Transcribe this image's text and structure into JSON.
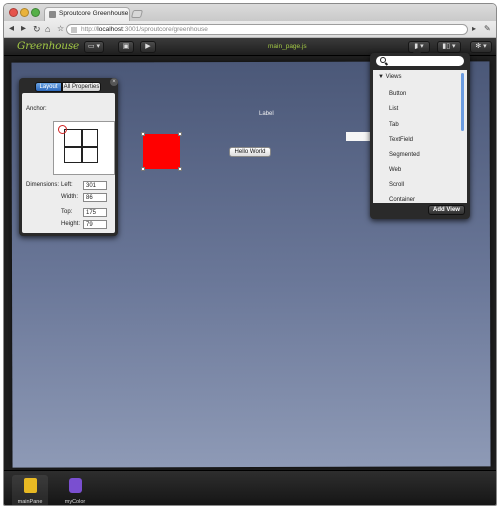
{
  "browser": {
    "tab_title": "Sproutcore Greenhouse",
    "tab_close": "×",
    "url_prefix": "http://",
    "url_host": "localhost",
    "url_path": ":3001/sproutcore/greenhouse",
    "nav_back": "◂",
    "nav_forward": "▸",
    "nav_reload": "↻",
    "nav_home": "⌂",
    "star": "☆",
    "menu_page": "▸",
    "menu_wrench": "✎"
  },
  "toolbar": {
    "logo": "Greenhouse",
    "folder_button": "▭ ▾",
    "save_button": "▣",
    "run_button": "▶",
    "page_file": "main_page.js",
    "library_button": "▮ ▾",
    "inspector_button": "▮▯ ▾",
    "settings_button": "✻ ▾"
  },
  "inspector": {
    "tab_layout": "Layout",
    "tab_all_properties": "All Properties",
    "close": "×",
    "anchor_label": "Anchor:",
    "dimensions_label": "Dimensions:",
    "fields": [
      {
        "label": "Left:",
        "value": "301"
      },
      {
        "label": "Width:",
        "value": "86"
      },
      {
        "label": "Top:",
        "value": "175"
      },
      {
        "label": "Height:",
        "value": "79"
      }
    ]
  },
  "canvas": {
    "label_text": "Label",
    "hello_button": "Hello World",
    "red_box_color": "#ff0000",
    "background_top": "#4b5878",
    "background_bottom": "#8e9ab6"
  },
  "library": {
    "search_placeholder": "",
    "header": "▼ Views",
    "items": [
      "Button",
      "List",
      "Tab",
      "TextField",
      "Segmented",
      "Web",
      "Scroll",
      "Container"
    ],
    "add_view_button": "Add View"
  },
  "dock": {
    "items": [
      {
        "label": "mainPane",
        "icon": "document-icon",
        "color": "#e8b923",
        "selected": true
      },
      {
        "label": "myColor",
        "icon": "controller-icon",
        "color": "#7a4fd0",
        "selected": false
      }
    ]
  },
  "colors": {
    "accent_green": "#a2c845",
    "selected_tab_blue": "#2c69bd"
  }
}
